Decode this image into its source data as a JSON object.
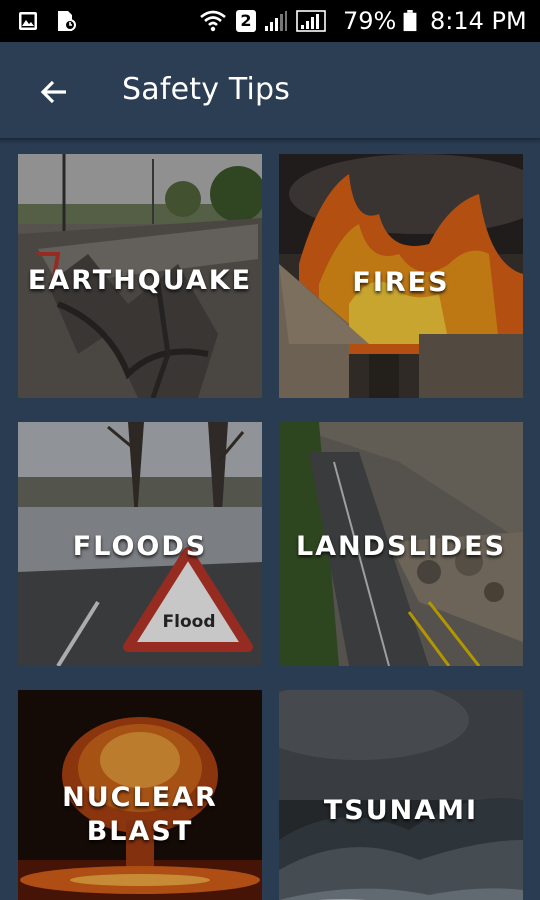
{
  "status_bar": {
    "icons": [
      "gallery-icon",
      "sim-card-icon",
      "wifi-icon",
      "sim-2-badge",
      "signal-icon",
      "signal-icon",
      "battery-icon"
    ],
    "sim_badge": "2",
    "battery": "79%",
    "time": "8:14 PM"
  },
  "app_bar": {
    "back_icon": "arrow-left-icon",
    "title": "Safety Tips",
    "color": "#2b3e54"
  },
  "tiles": [
    {
      "label": "EARTHQUAKE"
    },
    {
      "label": "FIRES"
    },
    {
      "label": "FLOODS",
      "sign_text": "Flood"
    },
    {
      "label": "LANDSLIDES"
    },
    {
      "label_line1": "NUCLEAR",
      "label_line2": "BLAST"
    },
    {
      "label": "TSUNAMI"
    }
  ],
  "colors": {
    "background": "#2a3c52",
    "status_bar": "#000000",
    "text": "#ffffff"
  }
}
